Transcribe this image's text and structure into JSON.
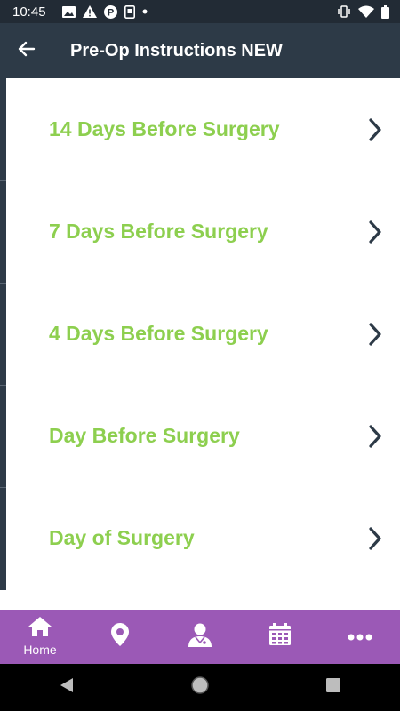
{
  "status_bar": {
    "time": "10:45",
    "left_icons": [
      "image-icon",
      "warning-icon",
      "p-badge-icon",
      "sim-icon",
      "dot-icon"
    ],
    "right_icons": [
      "vibrate-icon",
      "wifi-icon",
      "battery-icon"
    ]
  },
  "app_bar": {
    "title": "Pre-Op Instructions NEW",
    "back_icon": "arrow-left-icon"
  },
  "colors": {
    "accent_green": "#8dcf4f",
    "app_bar": "#2d3a47",
    "bottom_nav": "#9b59b6",
    "chevron": "#2d3a47"
  },
  "list": {
    "items": [
      {
        "label": "14 Days Before Surgery"
      },
      {
        "label": "7 Days Before Surgery"
      },
      {
        "label": "4 Days Before Surgery"
      },
      {
        "label": "Day Before Surgery"
      },
      {
        "label": "Day of Surgery"
      }
    ]
  },
  "bottom_nav": {
    "items": [
      {
        "icon": "home-icon",
        "label": "Home"
      },
      {
        "icon": "location-icon",
        "label": ""
      },
      {
        "icon": "doctor-icon",
        "label": ""
      },
      {
        "icon": "calendar-icon",
        "label": ""
      },
      {
        "icon": "more-icon",
        "label": ""
      }
    ]
  },
  "system_nav": {
    "items": [
      "back-triangle-icon",
      "home-circle-icon",
      "recents-square-icon"
    ]
  }
}
